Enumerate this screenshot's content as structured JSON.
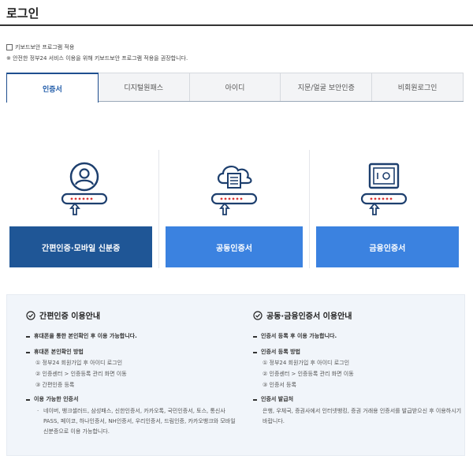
{
  "header": {
    "title": "로그인"
  },
  "keyboard": {
    "checkbox_label": "키보드보안 프로그램 적용",
    "note": "※ 안전한 정부24 서비스 이용을 위해 키보드보안 프로그램 적용을 권장합니다."
  },
  "tabs": [
    {
      "label": "인증서",
      "active": true
    },
    {
      "label": "디지털원패스",
      "active": false
    },
    {
      "label": "아이디",
      "active": false
    },
    {
      "label": "지문/얼굴 보안인증",
      "active": false
    },
    {
      "label": "비회원로그인",
      "active": false
    }
  ],
  "cards": [
    {
      "label": "간편인증·모바일 신분증",
      "icon": "person-key-icon",
      "color": "#1f5696"
    },
    {
      "label": "공동인증서",
      "icon": "cloud-document-key-icon",
      "color": "#3b82e0"
    },
    {
      "label": "금융인증서",
      "icon": "safe-key-icon",
      "color": "#3b82e0"
    }
  ],
  "info": {
    "left": {
      "title": "간편인증 이용안내",
      "s1": "휴대폰을 통한 본인확인 후 이용 가능합니다.",
      "s2": "휴대폰 본인확인 방법",
      "s2_steps": [
        "① 정부24 회원가입 후 아이디 로그인",
        "② 인증센터 > 인증등록 관리 화면 이동",
        "③ 간편인증 등록"
      ],
      "s3": "이용 가능한 인증서",
      "s3_text": "네이버, 뱅크샐러드, 삼성패스, 신한인증서, 카카오톡, 국민인증서, 토스, 통신사PASS, 페이코, 하나인증서, NH인증서, 우리인증서, 드림인증, 카카오뱅크와 모바일신분증으로 이용 가능합니다."
    },
    "right": {
      "title": "공동·금융인증서 이용안내",
      "s1": "인증서 등록 후 이용 가능합니다.",
      "s2": "인증서 등록 방법",
      "s2_steps": [
        "① 정부24 회원가입 후 아이디 로그인",
        "② 인증센터 > 인증등록 관리 화면 이동",
        "③ 인증서 등록"
      ],
      "s3": "인증서 발급처",
      "s3_text": "은행, 우체국, 증권사에서 인터넷뱅킹, 증권 거래용 인증서를 발급받으신 후 이용하시기 바랍니다."
    }
  },
  "colors": {
    "primary_dark": "#1f5696",
    "primary": "#3b82e0",
    "icon_navy": "#1d3f6e",
    "icon_red": "#d93a3a"
  }
}
